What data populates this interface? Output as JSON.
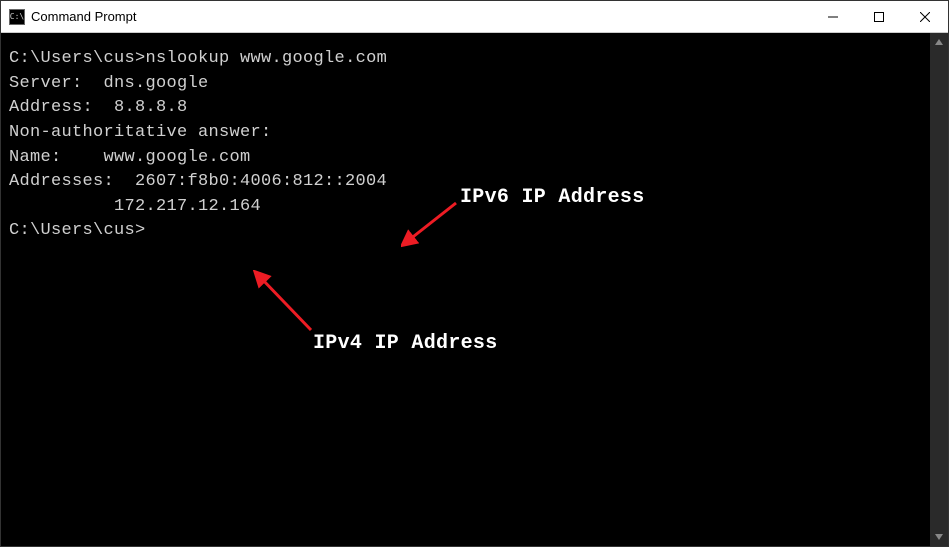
{
  "window": {
    "title": "Command Prompt"
  },
  "terminal": {
    "line1_prompt": "C:\\Users\\cus>",
    "line1_cmd": "nslookup www.google.com",
    "line2": "Server:  dns.google",
    "line3": "Address:  8.8.8.8",
    "line4": "",
    "line5": "Non-authoritative answer:",
    "line6": "Name:    www.google.com",
    "line7": "Addresses:  2607:f8b0:4006:812::2004",
    "line8": "          172.217.12.164",
    "line9": "",
    "line10": "",
    "line11_prompt": "C:\\Users\\cus>"
  },
  "annotations": {
    "ipv6": "IPv6 IP Address",
    "ipv4": "IPv4 IP Address"
  }
}
